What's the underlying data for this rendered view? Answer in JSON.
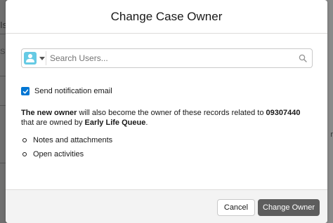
{
  "background": {
    "fragment_top": "Is",
    "fragment_mid": "S",
    "fragment_right": "r"
  },
  "modal": {
    "title": "Change Case Owner",
    "lookup": {
      "picker_icon": "user-icon",
      "search_placeholder": "Search Users...",
      "search_value": "",
      "search_icon": "search-icon"
    },
    "notify": {
      "checked": true,
      "label": "Send notification email"
    },
    "info": {
      "bold_prefix": "The new owner",
      "middle_text": " will also become the owner of these records related to ",
      "record_number": "09307440",
      "tail_text": " that are owned by ",
      "owner_name": "Early Life Queue",
      "end": "."
    },
    "related_items": [
      {
        "label": "Notes and attachments"
      },
      {
        "label": "Open activities"
      }
    ],
    "footer": {
      "cancel_label": "Cancel",
      "submit_label": "Change Owner"
    }
  },
  "colors": {
    "accent": "#0176d3",
    "user_icon": "#65cae4",
    "primary_button": "#5d5d5d",
    "overlay": "#8a8a8a"
  }
}
